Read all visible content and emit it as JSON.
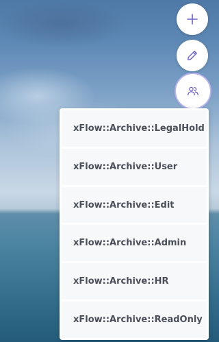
{
  "actions": {
    "add": {
      "icon": "plus-icon"
    },
    "edit": {
      "icon": "pencil-icon"
    },
    "users": {
      "icon": "users-icon"
    }
  },
  "accent_color": "#6b5ecf",
  "dropdown": {
    "items": [
      {
        "label": "xFlow::Archive::LegalHold"
      },
      {
        "label": "xFlow::Archive::User"
      },
      {
        "label": "xFlow::Archive::Edit"
      },
      {
        "label": "xFlow::Archive::Admin"
      },
      {
        "label": "xFlow::Archive::HR"
      },
      {
        "label": "xFlow::Archive::ReadOnly"
      }
    ]
  }
}
